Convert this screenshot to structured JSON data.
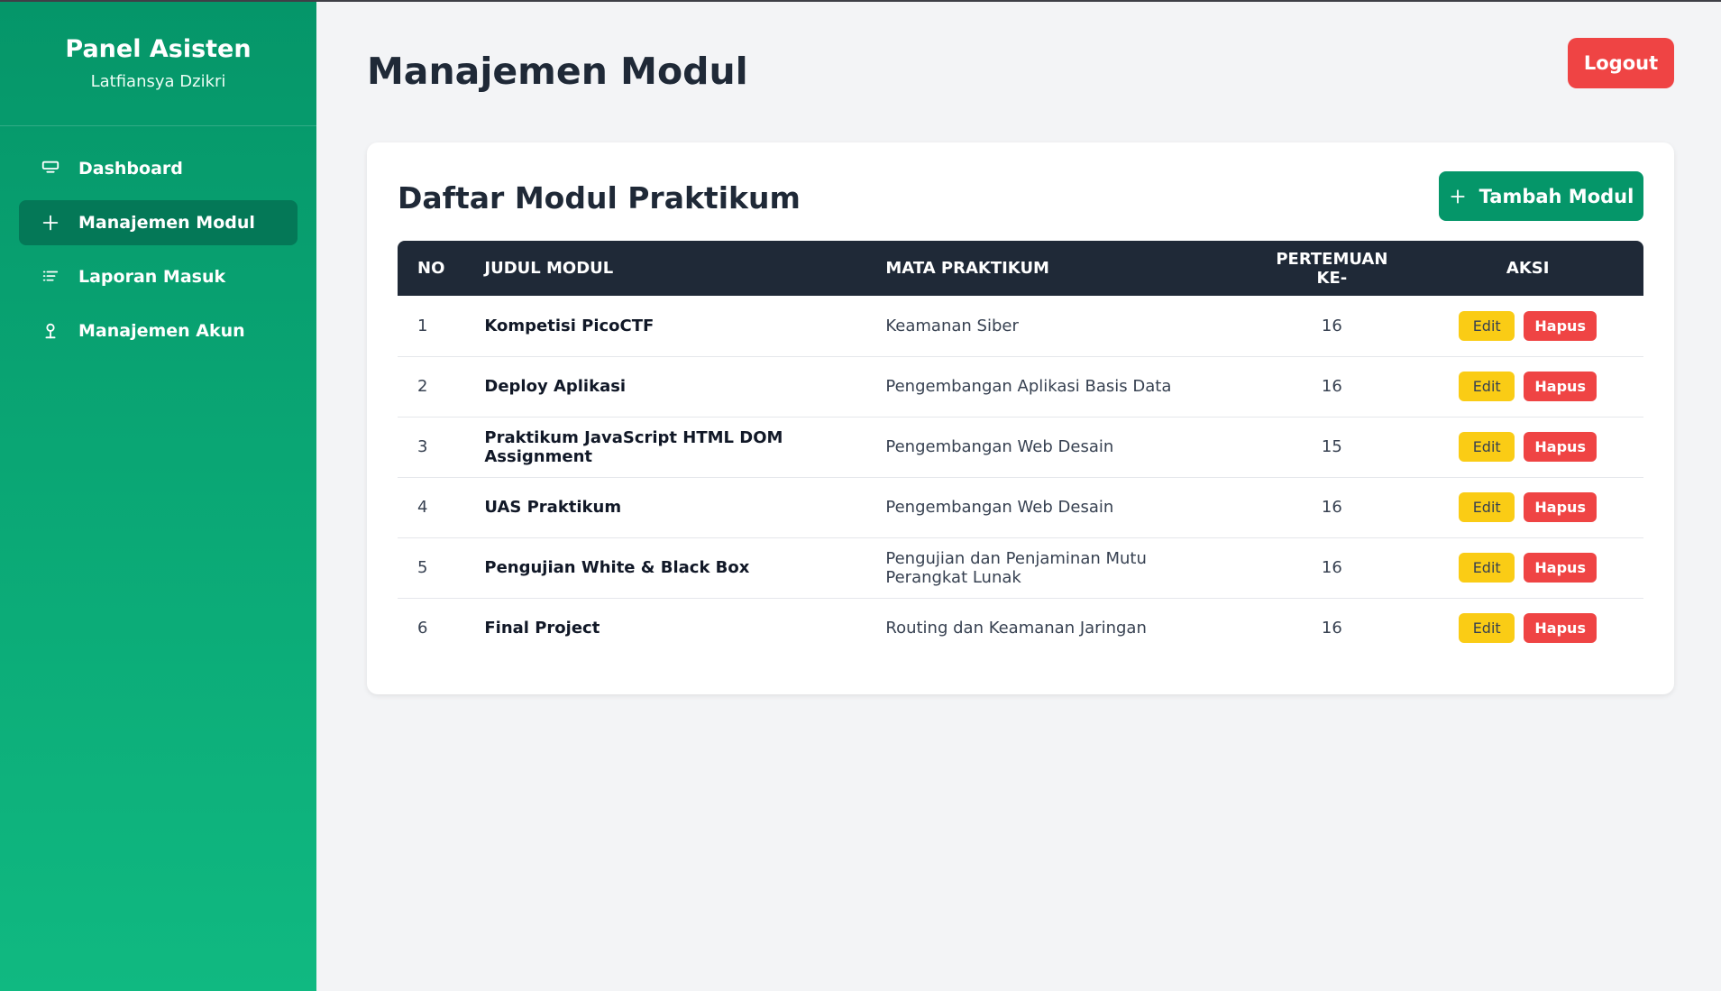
{
  "sidebar": {
    "title": "Panel Asisten",
    "user_name": "Latfiansya Dzikri",
    "items": [
      {
        "label": "Dashboard",
        "icon": "monitor-icon",
        "active": false
      },
      {
        "label": "Manajemen Modul",
        "icon": "plus-icon",
        "active": true
      },
      {
        "label": "Laporan Masuk",
        "icon": "list-icon",
        "active": false
      },
      {
        "label": "Manajemen Akun",
        "icon": "user-icon",
        "active": false
      }
    ]
  },
  "header": {
    "page_title": "Manajemen Modul",
    "logout_label": "Logout"
  },
  "card": {
    "title": "Daftar Modul Praktikum",
    "add_button_label": "Tambah Modul",
    "add_button_icon": "plus-icon"
  },
  "table": {
    "columns": [
      "NO",
      "JUDUL MODUL",
      "MATA PRAKTIKUM",
      "PERTEMUAN KE-",
      "AKSI"
    ],
    "edit_label": "Edit",
    "delete_label": "Hapus",
    "rows": [
      {
        "no": "1",
        "judul": "Kompetisi PicoCTF",
        "mata": "Keamanan Siber",
        "pertemuan": "16"
      },
      {
        "no": "2",
        "judul": "Deploy Aplikasi",
        "mata": "Pengembangan Aplikasi Basis Data",
        "pertemuan": "16"
      },
      {
        "no": "3",
        "judul": "Praktikum JavaScript HTML DOM Assignment",
        "mata": "Pengembangan Web Desain",
        "pertemuan": "15"
      },
      {
        "no": "4",
        "judul": "UAS Praktikum",
        "mata": "Pengembangan Web Desain",
        "pertemuan": "16"
      },
      {
        "no": "5",
        "judul": "Pengujian White & Black Box",
        "mata": "Pengujian dan Penjaminan Mutu Perangkat Lunak",
        "pertemuan": "16"
      },
      {
        "no": "6",
        "judul": "Final Project",
        "mata": "Routing dan Keamanan Jaringan",
        "pertemuan": "16"
      }
    ]
  },
  "colors": {
    "sidebar_top": "#059669",
    "sidebar_bottom": "#10b981",
    "active_item": "#047857",
    "danger": "#ef4444",
    "warning": "#facc15",
    "table_header": "#1f2937"
  }
}
